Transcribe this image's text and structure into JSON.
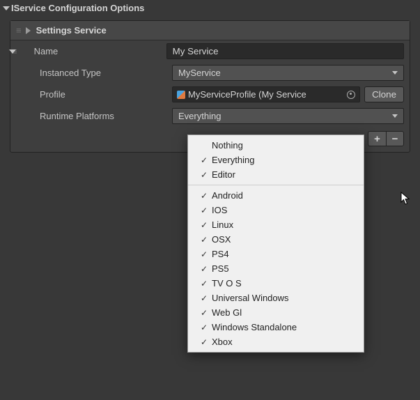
{
  "section": {
    "title": "IService Configuration Options"
  },
  "service": {
    "header": "Settings Service",
    "name_label": "Name",
    "name_value": "My Service",
    "type_label": "Instanced Type",
    "type_value": "MyService",
    "profile_label": "Profile",
    "profile_value": "MyServiceProfile (My Service",
    "clone_label": "Clone",
    "platforms_label": "Runtime Platforms",
    "platforms_value": "Everything"
  },
  "popup": {
    "items": [
      {
        "label": "Nothing",
        "checked": false
      },
      {
        "label": "Everything",
        "checked": true
      },
      {
        "label": "Editor",
        "checked": true
      }
    ],
    "items2": [
      {
        "label": "Android",
        "checked": true
      },
      {
        "label": "IOS",
        "checked": true
      },
      {
        "label": "Linux",
        "checked": true
      },
      {
        "label": "OSX",
        "checked": true
      },
      {
        "label": "PS4",
        "checked": true
      },
      {
        "label": "PS5",
        "checked": true
      },
      {
        "label": "TV O S",
        "checked": true
      },
      {
        "label": "Universal Windows",
        "checked": true
      },
      {
        "label": "Web Gl",
        "checked": true
      },
      {
        "label": "Windows Standalone",
        "checked": true
      },
      {
        "label": "Xbox",
        "checked": true
      }
    ]
  },
  "buttons": {
    "plus": "+",
    "minus": "−"
  }
}
